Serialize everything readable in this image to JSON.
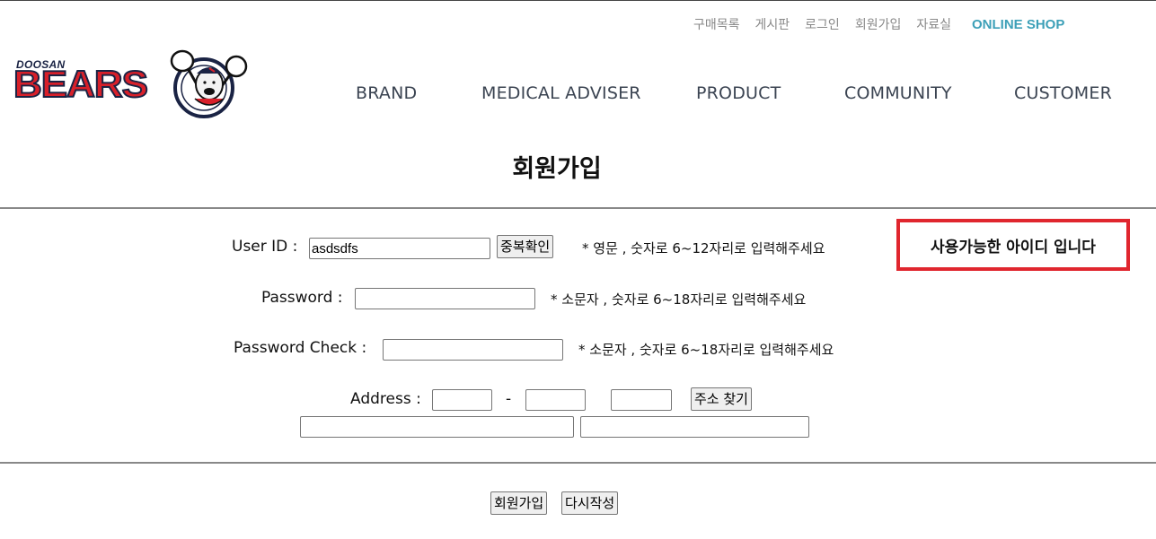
{
  "util_nav": {
    "items": [
      "구매목록",
      "게시판",
      "로그인",
      "회원가입",
      "자료실"
    ],
    "shop": "ONLINE SHOP"
  },
  "logo": {
    "small": "DOOSAN",
    "big": "BEARS"
  },
  "main_nav": [
    "BRAND",
    "MEDICAL ADVISER",
    "PRODUCT",
    "COMMUNITY",
    "CUSTOMER"
  ],
  "page_title": "회원가입",
  "form": {
    "userid_label": "User ID :",
    "userid_value": "asdsdfs",
    "check_button": "중복확인",
    "userid_hint": "* 영문 , 숫자로 6~12자리로 입력해주세요",
    "password_label": "Password :",
    "password_hint": "* 소문자 , 숫자로 6~18자리로 입력해주세요",
    "password_check_label": "Password Check :",
    "password_check_hint": "* 소문자 , 숫자로 6~18자리로 입력해주세요",
    "address_label": "Address :",
    "address_dash": "-",
    "address_search_button": "주소 찾기",
    "submit_button": "회원가입",
    "reset_button": "다시작성"
  },
  "availability_message": "사용가능한 아이디 입니다",
  "colors": {
    "accent": "#3da0b8",
    "alert_border": "#e0262e",
    "nav_text": "#3b4452",
    "logo_red": "#d8202a",
    "logo_navy": "#1a2344"
  }
}
